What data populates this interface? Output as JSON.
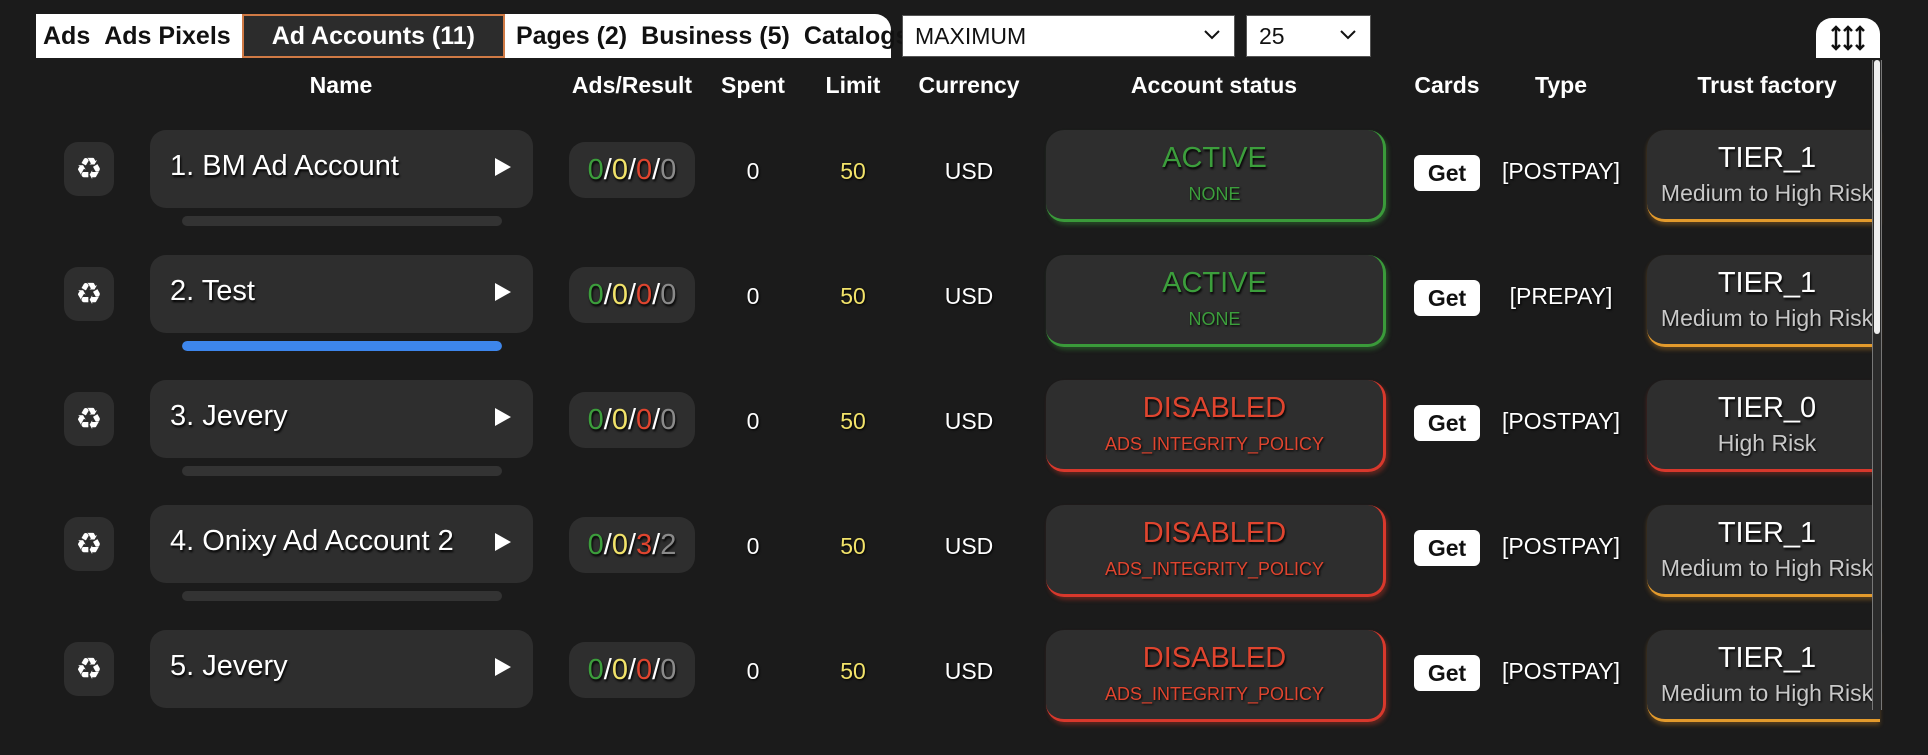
{
  "tabs": [
    {
      "label": "Ads"
    },
    {
      "label": "Ads Pixels"
    },
    {
      "label": "Ad Accounts (11)"
    },
    {
      "label": "Pages (2)"
    },
    {
      "label": "Business (5)"
    },
    {
      "label": "Catalogs"
    }
  ],
  "active_tab": 2,
  "mode_select": {
    "value": "MAXIMUM"
  },
  "count_select": {
    "value": "25"
  },
  "headers": {
    "name": "Name",
    "ads_result": "Ads/Result",
    "spent": "Spent",
    "limit": "Limit",
    "currency": "Currency",
    "account_status": "Account status",
    "cards": "Cards",
    "type": "Type",
    "trust_factor": "Trust factory"
  },
  "colors": {
    "active": "#3c9e3c",
    "disabled": "#e0452f",
    "limit": "#f2e36a",
    "progress": "#3d86ec",
    "tier_orange": "#e39a2c"
  },
  "rows": [
    {
      "name": "1. BM Ad Account",
      "ads": [
        "0",
        "0",
        "0",
        "0"
      ],
      "spent": "0",
      "limit": "50",
      "currency": "USD",
      "status": "ACTIVE",
      "status_reason": "NONE",
      "cards": "Get",
      "type": "[POSTPAY]",
      "tier": "TIER_1",
      "risk": "Medium to High Risk",
      "progress": 0
    },
    {
      "name": "2. Test",
      "ads": [
        "0",
        "0",
        "0",
        "0"
      ],
      "spent": "0",
      "limit": "50",
      "currency": "USD",
      "status": "ACTIVE",
      "status_reason": "NONE",
      "cards": "Get",
      "type": "[PREPAY]",
      "tier": "TIER_1",
      "risk": "Medium to High Risk",
      "progress": 1
    },
    {
      "name": "3. Jevery",
      "ads": [
        "0",
        "0",
        "0",
        "0"
      ],
      "spent": "0",
      "limit": "50",
      "currency": "USD",
      "status": "DISABLED",
      "status_reason": "ADS_INTEGRITY_POLICY",
      "cards": "Get",
      "type": "[POSTPAY]",
      "tier": "TIER_0",
      "risk": "High Risk",
      "progress": 0
    },
    {
      "name": "4. Onixy Ad Account 2",
      "ads": [
        "0",
        "0",
        "3",
        "2"
      ],
      "spent": "0",
      "limit": "50",
      "currency": "USD",
      "status": "DISABLED",
      "status_reason": "ADS_INTEGRITY_POLICY",
      "cards": "Get",
      "type": "[POSTPAY]",
      "tier": "TIER_1",
      "risk": "Medium to High Risk",
      "progress": 0
    },
    {
      "name": "5. Jevery",
      "ads": [
        "0",
        "0",
        "0",
        "0"
      ],
      "spent": "0",
      "limit": "50",
      "currency": "USD",
      "status": "DISABLED",
      "status_reason": "ADS_INTEGRITY_POLICY",
      "cards": "Get",
      "type": "[POSTPAY]",
      "tier": "TIER_1",
      "risk": "Medium to High Risk",
      "progress": null
    }
  ]
}
